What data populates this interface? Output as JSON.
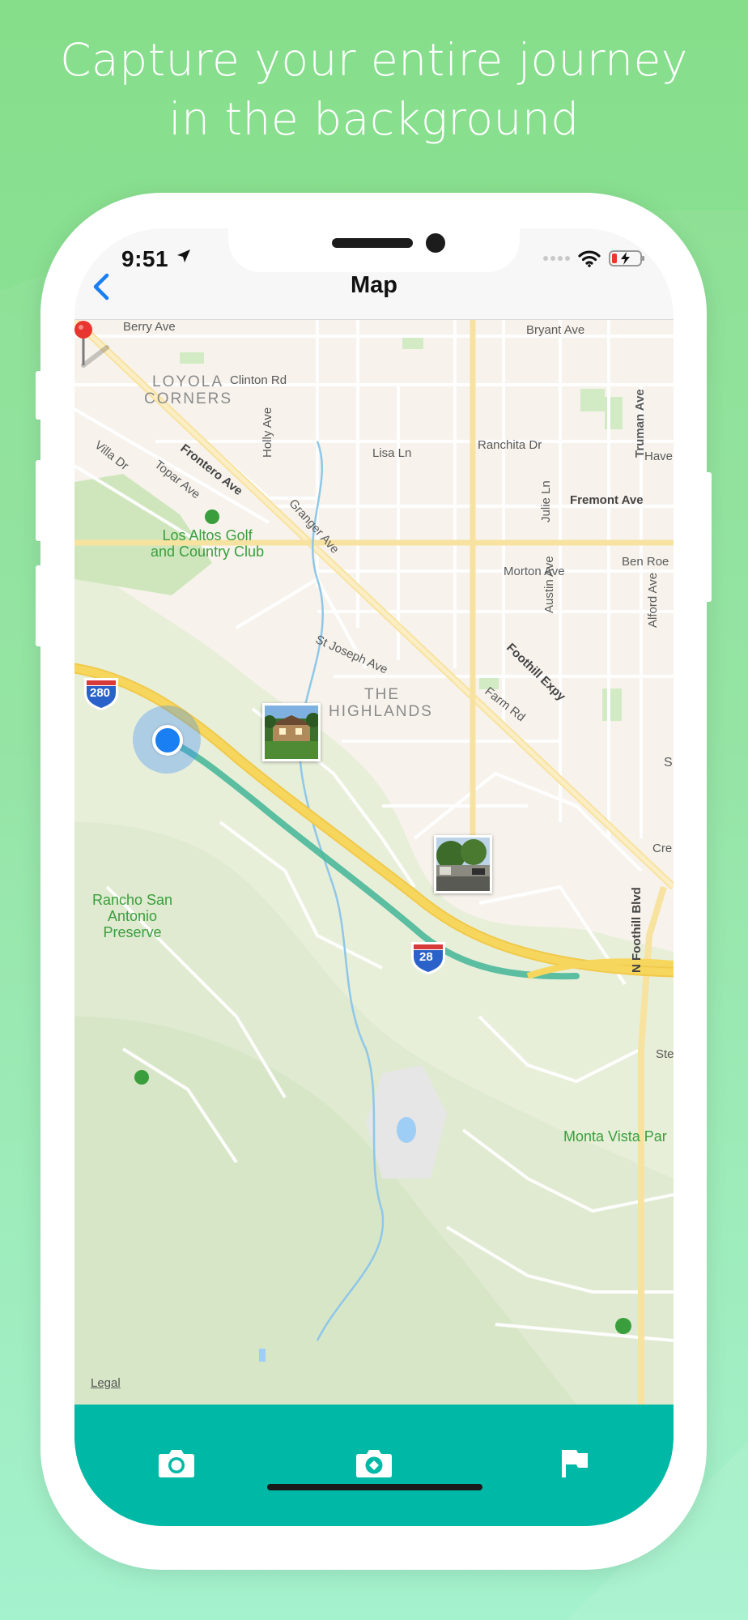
{
  "headline": {
    "line1": "Capture your entire journey",
    "line2": "in the background"
  },
  "status_bar": {
    "time": "9:51",
    "location_icon": "location-arrow-icon",
    "wifi_icon": "wifi-icon",
    "battery_icon": "battery-charging-low-icon"
  },
  "navbar": {
    "title": "Map",
    "back_icon": "chevron-left-icon"
  },
  "map": {
    "streets": {
      "berry_ave": "Berry Ave",
      "bryant_ave": "Bryant Ave",
      "clinton_rd": "Clinton Rd",
      "holly_ave": "Holly Ave",
      "truman_ave": "Truman Ave",
      "frontero_ave": "Frontero Ave",
      "villa_dr": "Villa Dr",
      "topar_ave": "Topar Ave",
      "lisa_ln": "Lisa Ln",
      "ranchita_dr": "Ranchita Dr",
      "have": "Have",
      "julie_ln": "Julie Ln",
      "fremont_ave": "Fremont Ave",
      "granger_ave": "Granger Ave",
      "austin_ave": "Austin Ave",
      "ben_roe": "Ben Roe",
      "morton_ave": "Morton Ave",
      "alford_ave": "Alford Ave",
      "st_joseph_ave": "St Joseph Ave",
      "foothill_expy": "Foothill Expy",
      "farm_rd": "Farm Rd",
      "s_fragment": "S",
      "cre_fragment": "Cre",
      "n_foothill_blvd": "N Foothill Blvd",
      "ste_fragment": "Ste"
    },
    "districts": {
      "loyola_corners_1": "LOYOLA",
      "loyola_corners_2": "CORNERS",
      "highlands_1": "THE",
      "highlands_2": "HIGHLANDS"
    },
    "parks": {
      "golf_1": "Los Altos Golf",
      "golf_2": "and Country Club",
      "rancho_1": "Rancho San",
      "rancho_2": "Antonio",
      "rancho_3": "Preserve",
      "monta_vista": "Monta Vista Par"
    },
    "shields": {
      "i280_a": "280",
      "i280_b": "28"
    },
    "legal": "Legal",
    "route_color": "#4db89a",
    "highway_color": "#f6d65c",
    "user_location_color": "#1a7ff2",
    "pin_color": "#e8352f"
  },
  "tabbar": {
    "background": "#00b8a6",
    "tabs": [
      {
        "icon": "camera-icon"
      },
      {
        "icon": "camera-add-icon"
      },
      {
        "icon": "flag-icon"
      }
    ]
  }
}
